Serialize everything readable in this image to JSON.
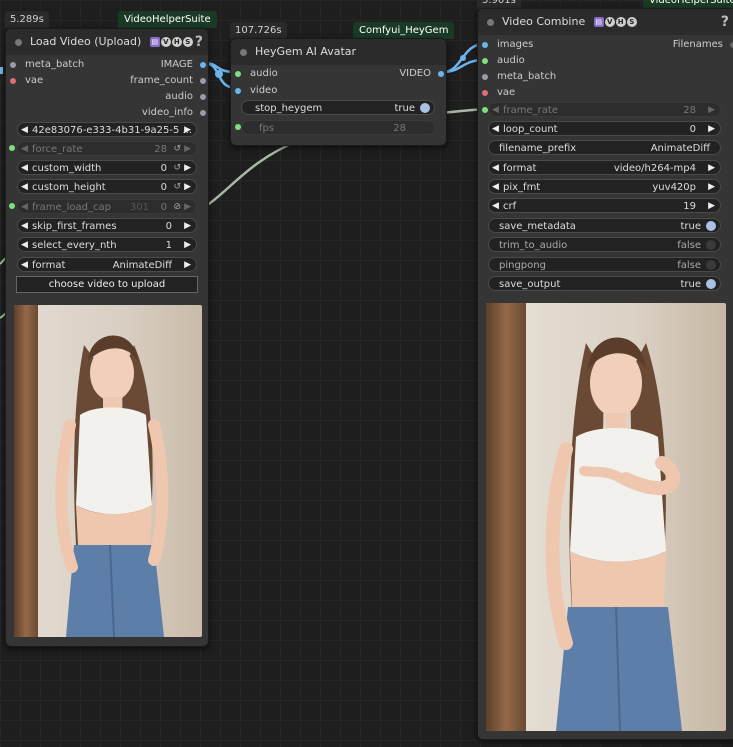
{
  "timers": {
    "load": "5.289s",
    "heygem": "107.726s",
    "combine": "5.901s"
  },
  "packs": {
    "vhs": "VideoHelperSuite",
    "heygem": "Comfyui_HeyGem"
  },
  "badges": {
    "v": "V",
    "h": "H",
    "s": "S"
  },
  "load_node": {
    "title": "Load Video (Upload)",
    "inputs": [
      "meta_batch",
      "vae"
    ],
    "outputs": [
      "IMAGE",
      "frame_count",
      "audio",
      "video_info"
    ],
    "widgets": {
      "video": "42e83076-e333-4b31-9a25-5 ...",
      "force_rate": {
        "label": "force_rate",
        "value": "28"
      },
      "custom_width": {
        "label": "custom_width",
        "value": "0"
      },
      "custom_height": {
        "label": "custom_height",
        "value": "0"
      },
      "frame_load_cap": {
        "label": "frame_load_cap",
        "hint": "301",
        "value": "0"
      },
      "skip_first_frames": {
        "label": "skip_first_frames",
        "value": "0"
      },
      "select_every_nth": {
        "label": "select_every_nth",
        "value": "1"
      },
      "format": {
        "label": "format",
        "value": "AnimateDiff"
      }
    },
    "upload_button": "choose video to upload"
  },
  "heygem_node": {
    "title": "HeyGem AI Avatar",
    "inputs": [
      "audio",
      "video"
    ],
    "outputs": [
      "VIDEO"
    ],
    "widgets": {
      "stop_heygem": {
        "label": "stop_heygem",
        "value": "true"
      },
      "fps": {
        "label": "fps",
        "value": "28"
      }
    }
  },
  "combine_node": {
    "title": "Video Combine",
    "inputs": [
      "images",
      "audio",
      "meta_batch",
      "vae"
    ],
    "outputs": [
      "Filenames"
    ],
    "widgets": {
      "frame_rate": {
        "label": "frame_rate",
        "value": "28"
      },
      "loop_count": {
        "label": "loop_count",
        "value": "0"
      },
      "filename_prefix": {
        "label": "filename_prefix",
        "value": "AnimateDiff"
      },
      "format": {
        "label": "format",
        "value": "video/h264-mp4"
      },
      "pix_fmt": {
        "label": "pix_fmt",
        "value": "yuv420p"
      },
      "crf": {
        "label": "crf",
        "value": "19"
      },
      "save_metadata": {
        "label": "save_metadata",
        "value": "true"
      },
      "trim_to_audio": {
        "label": "trim_to_audio",
        "value": "false"
      },
      "pingpong": {
        "label": "pingpong",
        "value": "false"
      },
      "save_output": {
        "label": "save_output",
        "value": "true"
      }
    }
  },
  "colors": {
    "canvas": "#1e1e1e",
    "node": "#353535",
    "title": "#2b2b2b",
    "link_image": "#6cb6f0",
    "link_other": "#a7b9a4",
    "pack_tag": "#1a3a26"
  }
}
